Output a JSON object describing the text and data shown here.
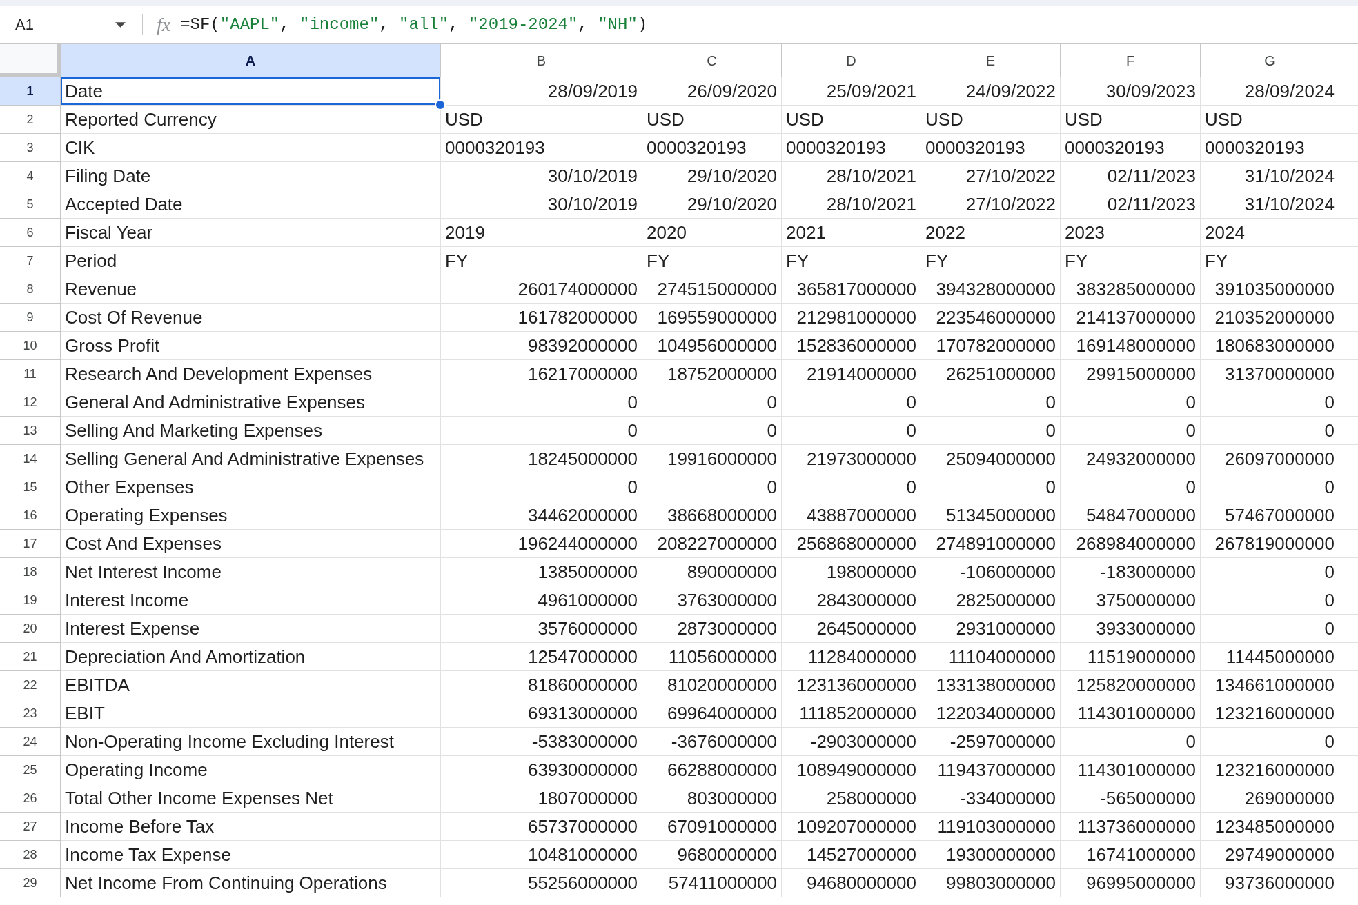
{
  "name_box": {
    "value": "A1"
  },
  "formula_bar": {
    "function_label": "fx",
    "tokens": [
      {
        "kind": "plain",
        "text": "=SF("
      },
      {
        "kind": "string",
        "text": "\"AAPL\""
      },
      {
        "kind": "plain",
        "text": ", "
      },
      {
        "kind": "string",
        "text": "\"income\""
      },
      {
        "kind": "plain",
        "text": ", "
      },
      {
        "kind": "string",
        "text": "\"all\""
      },
      {
        "kind": "plain",
        "text": ", "
      },
      {
        "kind": "string",
        "text": "\"2019-2024\""
      },
      {
        "kind": "plain",
        "text": ", "
      },
      {
        "kind": "string",
        "text": "\"NH\""
      },
      {
        "kind": "plain",
        "text": ")"
      }
    ]
  },
  "columns": [
    {
      "label": "A",
      "selected": true
    },
    {
      "label": "B",
      "selected": false
    },
    {
      "label": "C",
      "selected": false
    },
    {
      "label": "D",
      "selected": false
    },
    {
      "label": "E",
      "selected": false
    },
    {
      "label": "F",
      "selected": false
    },
    {
      "label": "G",
      "selected": false
    }
  ],
  "rows": [
    {
      "number": "1",
      "selected": true,
      "kind": "number",
      "cells": [
        "Date",
        "28/09/2019",
        "26/09/2020",
        "25/09/2021",
        "24/09/2022",
        "30/09/2023",
        "28/09/2024"
      ]
    },
    {
      "number": "2",
      "selected": false,
      "kind": "text",
      "cells": [
        "Reported Currency",
        "USD",
        "USD",
        "USD",
        "USD",
        "USD",
        "USD"
      ]
    },
    {
      "number": "3",
      "selected": false,
      "kind": "text",
      "cells": [
        "CIK",
        "0000320193",
        "0000320193",
        "0000320193",
        "0000320193",
        "0000320193",
        "0000320193"
      ]
    },
    {
      "number": "4",
      "selected": false,
      "kind": "number",
      "cells": [
        "Filing Date",
        "30/10/2019",
        "29/10/2020",
        "28/10/2021",
        "27/10/2022",
        "02/11/2023",
        "31/10/2024"
      ]
    },
    {
      "number": "5",
      "selected": false,
      "kind": "number",
      "cells": [
        "Accepted Date",
        "30/10/2019",
        "29/10/2020",
        "28/10/2021",
        "27/10/2022",
        "02/11/2023",
        "31/10/2024"
      ]
    },
    {
      "number": "6",
      "selected": false,
      "kind": "text",
      "cells": [
        "Fiscal Year",
        "2019",
        "2020",
        "2021",
        "2022",
        "2023",
        "2024"
      ]
    },
    {
      "number": "7",
      "selected": false,
      "kind": "text",
      "cells": [
        "Period",
        "FY",
        "FY",
        "FY",
        "FY",
        "FY",
        "FY"
      ]
    },
    {
      "number": "8",
      "selected": false,
      "kind": "number",
      "cells": [
        "Revenue",
        "260174000000",
        "274515000000",
        "365817000000",
        "394328000000",
        "383285000000",
        "391035000000"
      ]
    },
    {
      "number": "9",
      "selected": false,
      "kind": "number",
      "cells": [
        "Cost Of Revenue",
        "161782000000",
        "169559000000",
        "212981000000",
        "223546000000",
        "214137000000",
        "210352000000"
      ]
    },
    {
      "number": "10",
      "selected": false,
      "kind": "number",
      "cells": [
        "Gross Profit",
        "98392000000",
        "104956000000",
        "152836000000",
        "170782000000",
        "169148000000",
        "180683000000"
      ]
    },
    {
      "number": "11",
      "selected": false,
      "kind": "number",
      "cells": [
        "Research And Development Expenses",
        "16217000000",
        "18752000000",
        "21914000000",
        "26251000000",
        "29915000000",
        "31370000000"
      ]
    },
    {
      "number": "12",
      "selected": false,
      "kind": "number",
      "cells": [
        "General And Administrative Expenses",
        "0",
        "0",
        "0",
        "0",
        "0",
        "0"
      ]
    },
    {
      "number": "13",
      "selected": false,
      "kind": "number",
      "cells": [
        "Selling And Marketing Expenses",
        "0",
        "0",
        "0",
        "0",
        "0",
        "0"
      ]
    },
    {
      "number": "14",
      "selected": false,
      "kind": "number",
      "cells": [
        "Selling General And Administrative Expenses",
        "18245000000",
        "19916000000",
        "21973000000",
        "25094000000",
        "24932000000",
        "26097000000"
      ]
    },
    {
      "number": "15",
      "selected": false,
      "kind": "number",
      "cells": [
        "Other Expenses",
        "0",
        "0",
        "0",
        "0",
        "0",
        "0"
      ]
    },
    {
      "number": "16",
      "selected": false,
      "kind": "number",
      "cells": [
        "Operating Expenses",
        "34462000000",
        "38668000000",
        "43887000000",
        "51345000000",
        "54847000000",
        "57467000000"
      ]
    },
    {
      "number": "17",
      "selected": false,
      "kind": "number",
      "cells": [
        "Cost And Expenses",
        "196244000000",
        "208227000000",
        "256868000000",
        "274891000000",
        "268984000000",
        "267819000000"
      ]
    },
    {
      "number": "18",
      "selected": false,
      "kind": "number",
      "cells": [
        "Net Interest Income",
        "1385000000",
        "890000000",
        "198000000",
        "-106000000",
        "-183000000",
        "0"
      ]
    },
    {
      "number": "19",
      "selected": false,
      "kind": "number",
      "cells": [
        "Interest Income",
        "4961000000",
        "3763000000",
        "2843000000",
        "2825000000",
        "3750000000",
        "0"
      ]
    },
    {
      "number": "20",
      "selected": false,
      "kind": "number",
      "cells": [
        "Interest Expense",
        "3576000000",
        "2873000000",
        "2645000000",
        "2931000000",
        "3933000000",
        "0"
      ]
    },
    {
      "number": "21",
      "selected": false,
      "kind": "number",
      "cells": [
        "Depreciation And Amortization",
        "12547000000",
        "11056000000",
        "11284000000",
        "11104000000",
        "11519000000",
        "11445000000"
      ]
    },
    {
      "number": "22",
      "selected": false,
      "kind": "number",
      "cells": [
        "EBITDA",
        "81860000000",
        "81020000000",
        "123136000000",
        "133138000000",
        "125820000000",
        "134661000000"
      ]
    },
    {
      "number": "23",
      "selected": false,
      "kind": "number",
      "cells": [
        "EBIT",
        "69313000000",
        "69964000000",
        "111852000000",
        "122034000000",
        "114301000000",
        "123216000000"
      ]
    },
    {
      "number": "24",
      "selected": false,
      "kind": "number",
      "cells": [
        "Non-Operating Income Excluding Interest",
        "-5383000000",
        "-3676000000",
        "-2903000000",
        "-2597000000",
        "0",
        "0"
      ]
    },
    {
      "number": "25",
      "selected": false,
      "kind": "number",
      "cells": [
        "Operating Income",
        "63930000000",
        "66288000000",
        "108949000000",
        "119437000000",
        "114301000000",
        "123216000000"
      ]
    },
    {
      "number": "26",
      "selected": false,
      "kind": "number",
      "cells": [
        "Total Other Income Expenses Net",
        "1807000000",
        "803000000",
        "258000000",
        "-334000000",
        "-565000000",
        "269000000"
      ]
    },
    {
      "number": "27",
      "selected": false,
      "kind": "number",
      "cells": [
        "Income Before Tax",
        "65737000000",
        "67091000000",
        "109207000000",
        "119103000000",
        "113736000000",
        "123485000000"
      ]
    },
    {
      "number": "28",
      "selected": false,
      "kind": "number",
      "cells": [
        "Income Tax Expense",
        "10481000000",
        "9680000000",
        "14527000000",
        "19300000000",
        "16741000000",
        "29749000000"
      ]
    },
    {
      "number": "29",
      "selected": false,
      "kind": "number",
      "cells": [
        "Net Income From Continuing Operations",
        "55256000000",
        "57411000000",
        "94680000000",
        "99803000000",
        "96995000000",
        "93736000000"
      ]
    }
  ]
}
